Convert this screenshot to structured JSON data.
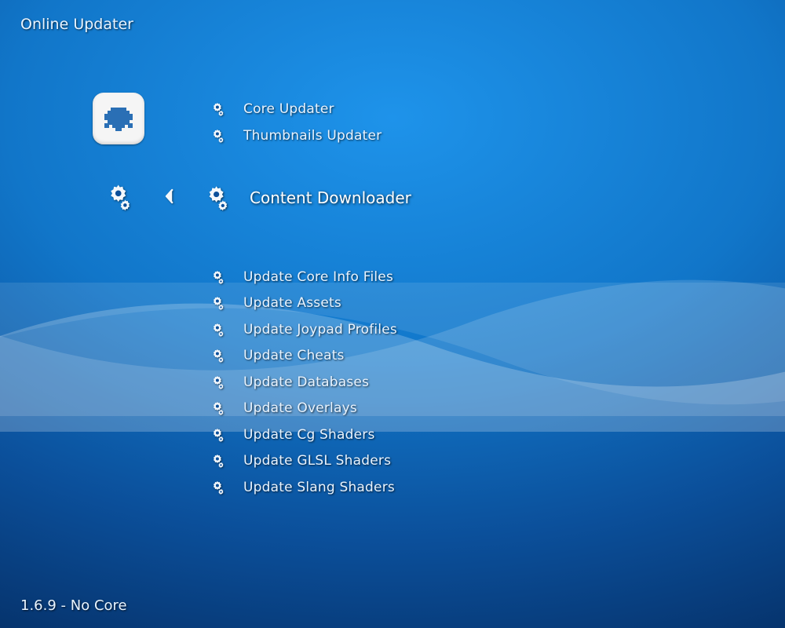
{
  "header": {
    "title": "Online Updater"
  },
  "footer": {
    "status": "1.6.9 - No Core"
  },
  "colors": {
    "accent": "#1e93ea",
    "text": "#e8f4ff"
  },
  "menu": {
    "top": [
      {
        "label": "Core Updater"
      },
      {
        "label": "Thumbnails Updater"
      }
    ],
    "selected": {
      "label": "Content Downloader"
    },
    "bottom": [
      {
        "label": "Update Core Info Files"
      },
      {
        "label": "Update Assets"
      },
      {
        "label": "Update Joypad Profiles"
      },
      {
        "label": "Update Cheats"
      },
      {
        "label": "Update Databases"
      },
      {
        "label": "Update Overlays"
      },
      {
        "label": "Update Cg Shaders"
      },
      {
        "label": "Update GLSL Shaders"
      },
      {
        "label": "Update Slang Shaders"
      }
    ]
  }
}
